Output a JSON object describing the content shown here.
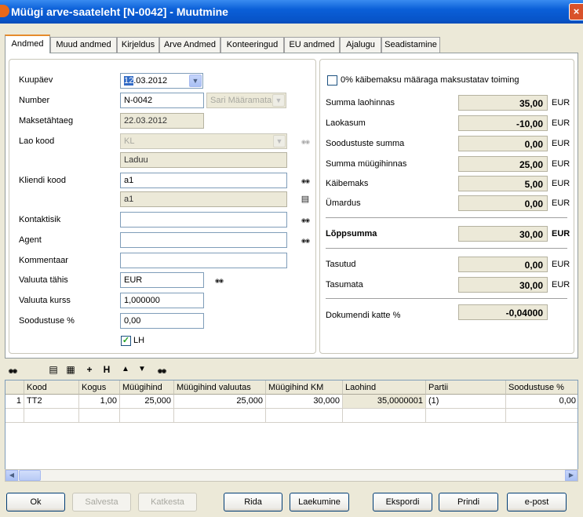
{
  "window": {
    "title": "Müügi arve-saateleht [N-0042] - Muutmine",
    "close_glyph": "×"
  },
  "tabs": [
    "Andmed",
    "Muud andmed",
    "Kirjeldus",
    "Arve Andmed",
    "Konteeringud",
    "EU andmed",
    "Ajalugu",
    "Seadistamine"
  ],
  "active_tab": "Andmed",
  "left": {
    "date_label": "Kuupäev",
    "date_value_selected": "12",
    "date_value_rest": ".03.2012",
    "number_label": "Number",
    "number_value": "N-0042",
    "series_value": "Sari Määramata",
    "due_label": "Maksetähtaeg",
    "due_value": "22.03.2012",
    "warehouse_label": "Lao kood",
    "warehouse_code": "KL",
    "warehouse_name": "Laduu",
    "client_label": "Kliendi kood",
    "client_code": "a1",
    "client_name": "a1",
    "contact_label": "Kontaktisik",
    "contact_value": "",
    "agent_label": "Agent",
    "agent_value": "",
    "comment_label": "Kommentaar",
    "comment_value": "",
    "currency_label": "Valuuta tähis",
    "currency_value": "EUR",
    "rate_label": "Valuuta kurss",
    "rate_value": "1,000000",
    "discount_label": "Soodustuse %",
    "discount_value": "0,00",
    "lh_label": "LH",
    "lh_checked": true
  },
  "right": {
    "zero_vat_label": "0% käibemaksu määraga maksustatav toiming",
    "zero_vat_checked": false,
    "currency": "EUR",
    "rows": [
      {
        "label": "Summa laohinnas",
        "value": "35,00"
      },
      {
        "label": "Laokasum",
        "value": "-10,00"
      },
      {
        "label": "Soodustuste summa",
        "value": "0,00"
      },
      {
        "label": "Summa müügihinnas",
        "value": "25,00"
      },
      {
        "label": "Käibemaks",
        "value": "5,00"
      },
      {
        "label": "Ümardus",
        "value": "0,00"
      }
    ],
    "total_label": "Lõppsumma",
    "total_value": "30,00",
    "paid_label": "Tasutud",
    "paid_value": "0,00",
    "unpaid_label": "Tasumata",
    "unpaid_value": "30,00",
    "margin_label": "Dokumendi katte %",
    "margin_value": "-0,04000"
  },
  "toolbar": {
    "add_label": "+",
    "header_label": "H",
    "up_label": "▲",
    "down_label": "▼"
  },
  "grid": {
    "columns": [
      "Kood",
      "Kogus",
      "Müügihind",
      "Müügihind valuutas",
      "Müügihind KM",
      "Laohind",
      "Partii",
      "Soodustuse %"
    ],
    "rows": [
      {
        "index": "1",
        "cells": [
          "TT2",
          "1,00",
          "25,000",
          "25,000",
          "30,000",
          "35,0000001",
          "(1)",
          "0,00"
        ]
      }
    ]
  },
  "buttons": {
    "ok": "Ok",
    "save": "Salvesta",
    "cancel": "Katkesta",
    "row": "Rida",
    "receipt": "Laekumine",
    "export": "Ekspordi",
    "print": "Prindi",
    "email": "e-post"
  }
}
